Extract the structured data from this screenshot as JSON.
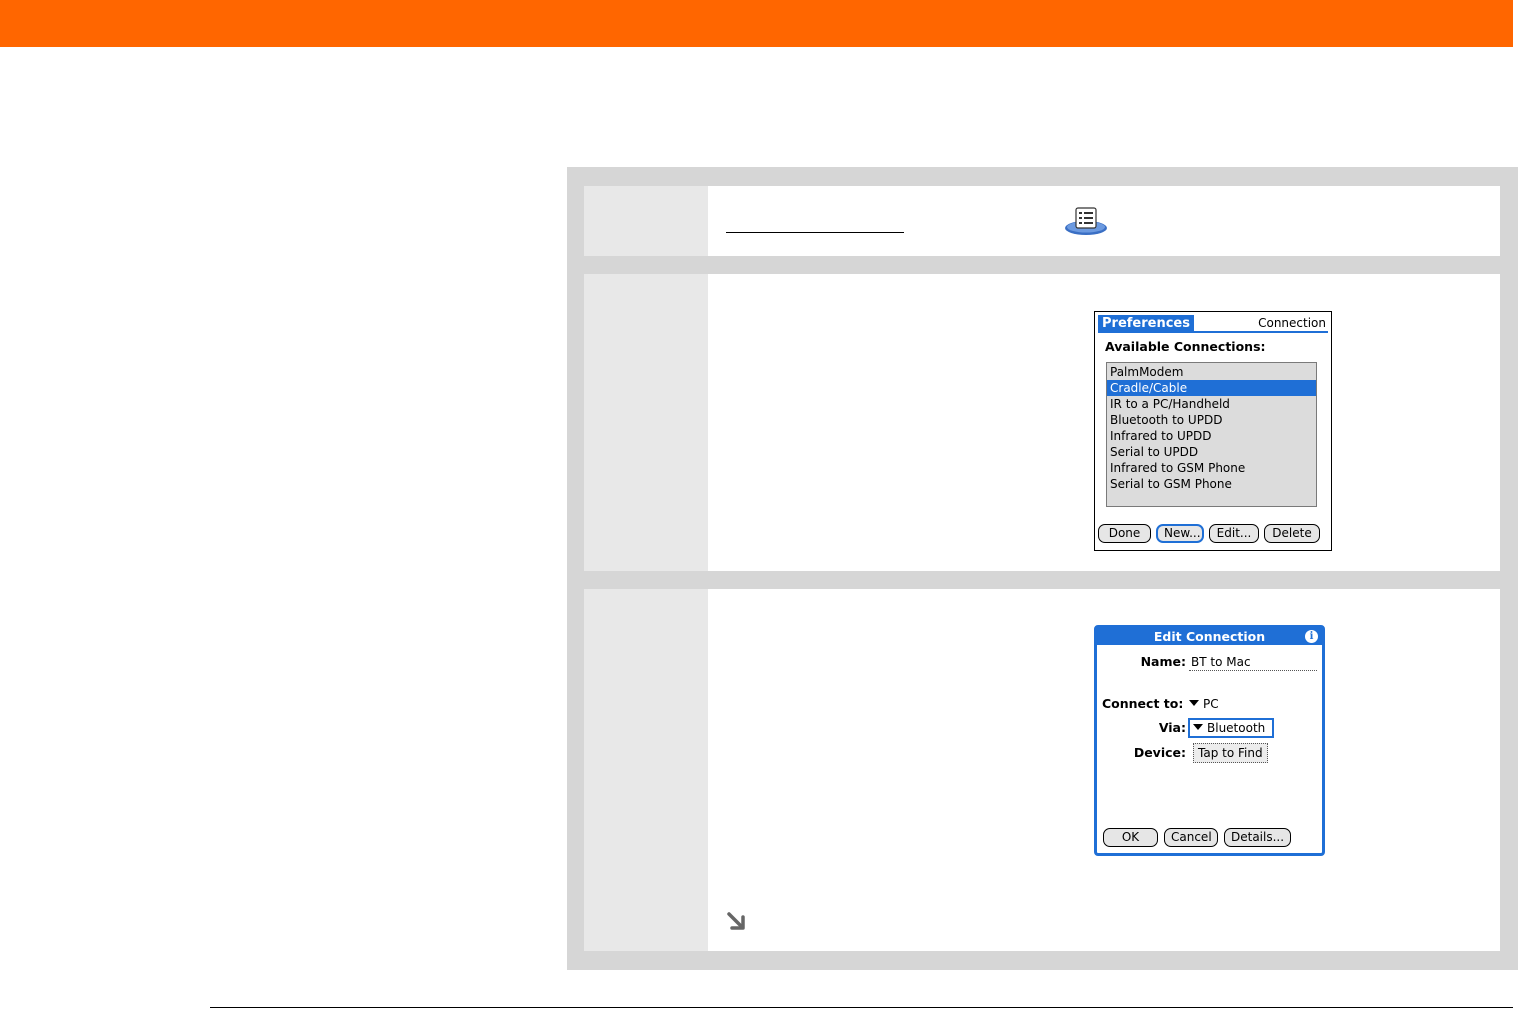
{
  "colors": {
    "accent": "#ff6600",
    "palm_blue": "#1f6fd6",
    "panel_gray": "#d6d6d6"
  },
  "step1": {
    "icon": "preferences-app-icon"
  },
  "prefs_screen": {
    "tab": "Preferences",
    "panel": "Connection",
    "heading": "Available Connections:",
    "connections": [
      "PalmModem",
      "Cradle/Cable",
      "IR to a PC/Handheld",
      "Bluetooth to UPDD",
      "Infrared to UPDD",
      "Serial to UPDD",
      "Infrared to GSM Phone",
      "Serial to GSM Phone"
    ],
    "selected_connection": "Cradle/Cable",
    "buttons": {
      "done": "Done",
      "new": "New...",
      "edit": "Edit...",
      "delete": "Delete"
    }
  },
  "edit_screen": {
    "title": "Edit Connection",
    "info_glyph": "i",
    "name_label": "Name:",
    "name_value": "BT to Mac",
    "connect_to_label": "Connect to:",
    "connect_to_value": "PC",
    "via_label": "Via:",
    "via_value": "Bluetooth",
    "device_label": "Device:",
    "device_button": "Tap to Find",
    "buttons": {
      "ok": "OK",
      "cancel": "Cancel",
      "details": "Details..."
    }
  },
  "continue": {
    "icon": "continue-arrow-icon"
  }
}
